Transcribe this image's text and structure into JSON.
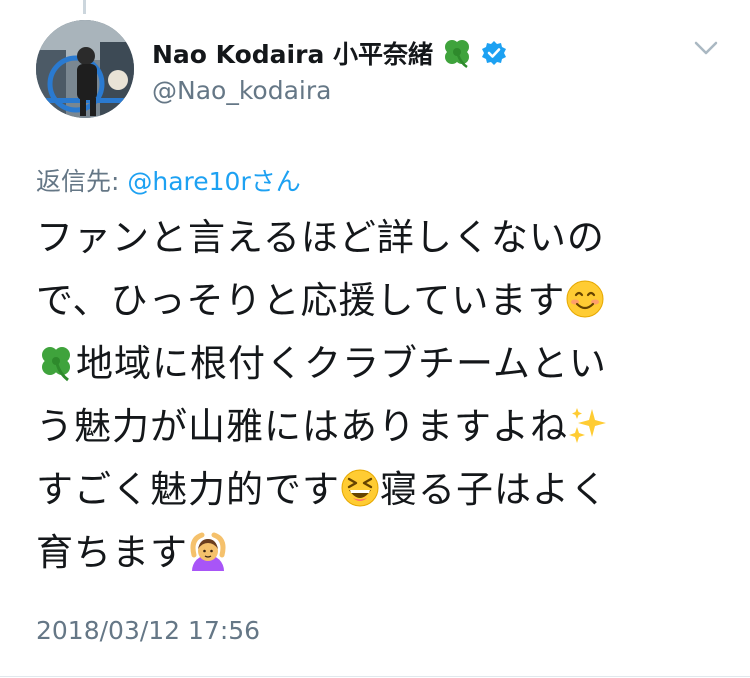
{
  "tweet": {
    "author": {
      "display_name": "Nao Kodaira 小平奈緒",
      "handle": "@Nao_kodaira",
      "verified": true,
      "name_emoji": "four-leaf-clover-icon",
      "verified_icon": "verified-badge-icon",
      "avatar_icon": "avatar-photo"
    },
    "menu_icon": "chevron-down-icon",
    "reply": {
      "prefix": "返信先: ",
      "mention": "@hare10rさん"
    },
    "body": {
      "line1": "ファンと言えるほど詳しくないの",
      "line2": "で、ひっそりと応援しています",
      "line3": "地域に根付くクラブチームとい",
      "line4": "う魅力が山雅にはありますよね",
      "line5a": "すごく魅力的です",
      "line5b": "寝る子はよく",
      "line6": "育ちます"
    },
    "emojis": [
      "smiling-face-icon",
      "four-leaf-clover-icon",
      "sparkles-icon",
      "laughing-face-icon",
      "person-gesturing-ok-icon"
    ],
    "timestamp": "2018/03/12 17:56",
    "colors": {
      "link": "#1da1f2",
      "secondary_text": "#657786",
      "primary_text": "#14171a",
      "verified": "#1da1f2"
    }
  }
}
